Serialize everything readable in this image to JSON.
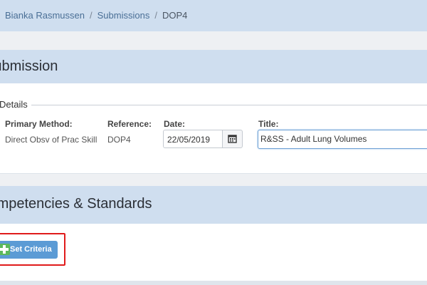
{
  "breadcrumb": {
    "user": "Bianka Rasmussen",
    "section": "Submissions",
    "current": "DOP4",
    "separator": "/"
  },
  "submission": {
    "heading": "Submission",
    "details_legend": "Details",
    "primary_method_label": "Primary Method:",
    "primary_method_value": "Direct Obsv of Prac Skill",
    "reference_label": "Reference:",
    "reference_value": "DOP4",
    "date_label": "Date:",
    "date_value": "22/05/2019",
    "title_label": "Title:",
    "title_value": "R&SS - Adult Lung Volumes"
  },
  "competencies": {
    "heading": "Competencies & Standards",
    "set_criteria_label": "Set Criteria"
  },
  "icons": {
    "calendar": "calendar-icon",
    "add": "plus-icon"
  },
  "colors": {
    "panel_header": "#cfdeef",
    "button_primary": "#5b9bd5",
    "add_icon": "#5cb85c",
    "highlight": "#e01b1b",
    "link": "#4a6f96"
  }
}
